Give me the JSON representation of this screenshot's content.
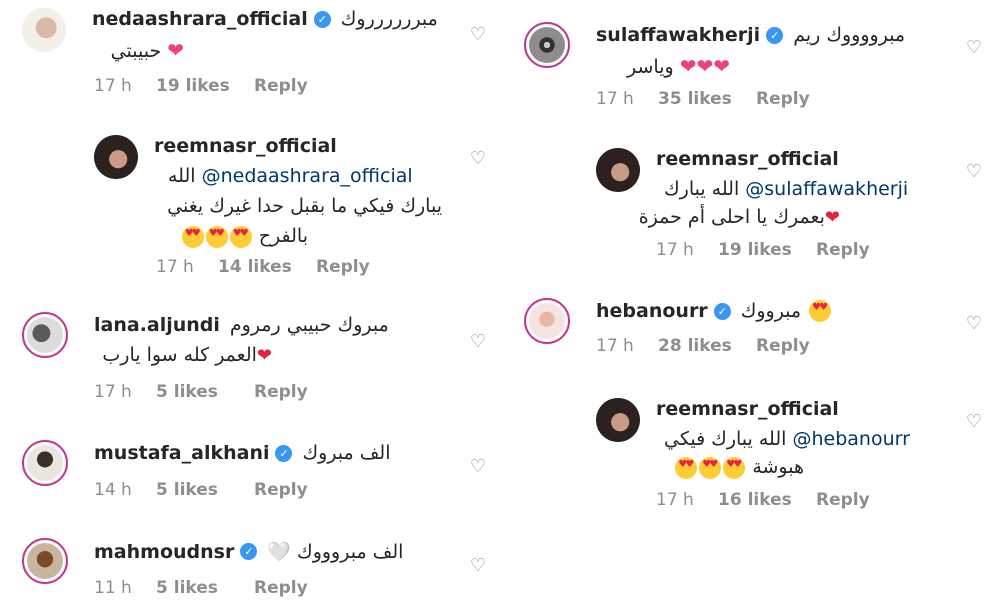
{
  "left": [
    {
      "username": "nedaashrara_official",
      "verified": true,
      "text": "مبرررررروك",
      "line2": "حبيبتي",
      "time": "17 h",
      "likes": "19 likes",
      "reply": "Reply"
    },
    {
      "username": "reemnasr_official",
      "verified": false,
      "mention": "@nedaashrara_official",
      "text": "الله",
      "line2": "يبارك فيكي ما بقبل حدا غيرك يغني",
      "line3": "بالفرح",
      "time": "17 h",
      "likes": "14 likes",
      "reply": "Reply"
    },
    {
      "username": "lana.aljundi",
      "verified": false,
      "text": "مبروك حبيبي رمروم",
      "line2": "العمر كله سوا يارب",
      "time": "17 h",
      "likes": "5 likes",
      "reply": "Reply"
    },
    {
      "username": "mustafa_alkhani",
      "verified": true,
      "text": "الف مبروك",
      "time": "14 h",
      "likes": "5 likes",
      "reply": "Reply"
    },
    {
      "username": "mahmoudnsr",
      "verified": true,
      "text": "الف مبروووك 🤍",
      "time": "11 h",
      "likes": "5 likes",
      "reply": "Reply"
    }
  ],
  "right": [
    {
      "username": "sulaffawakherji",
      "verified": true,
      "text": "مبرووووك ريم",
      "line2": "وياسر",
      "time": "17 h",
      "likes": "35 likes",
      "reply": "Reply"
    },
    {
      "username": "reemnasr_official",
      "verified": false,
      "mention": "@sulaffawakherji",
      "text": "الله يبارك",
      "line2": "بعمرك يا احلى أم حمزة",
      "time": "17 h",
      "likes": "19 likes",
      "reply": "Reply"
    },
    {
      "username": "hebanourr",
      "verified": true,
      "text": "مبرووك",
      "time": "17 h",
      "likes": "28 likes",
      "reply": "Reply"
    },
    {
      "username": "reemnasr_official",
      "verified": false,
      "mention": "@hebanourr",
      "text": "الله يبارك فيكي",
      "line2": "هبوشة",
      "time": "17 h",
      "likes": "16 likes",
      "reply": "Reply"
    }
  ],
  "icons": {
    "verified": "verified-badge-icon",
    "like": "heart-outline-icon"
  },
  "colors": {
    "verified": "#3897f0",
    "mention": "#00376b",
    "ring": "#c4368c",
    "meta": "#8e8e8e"
  }
}
